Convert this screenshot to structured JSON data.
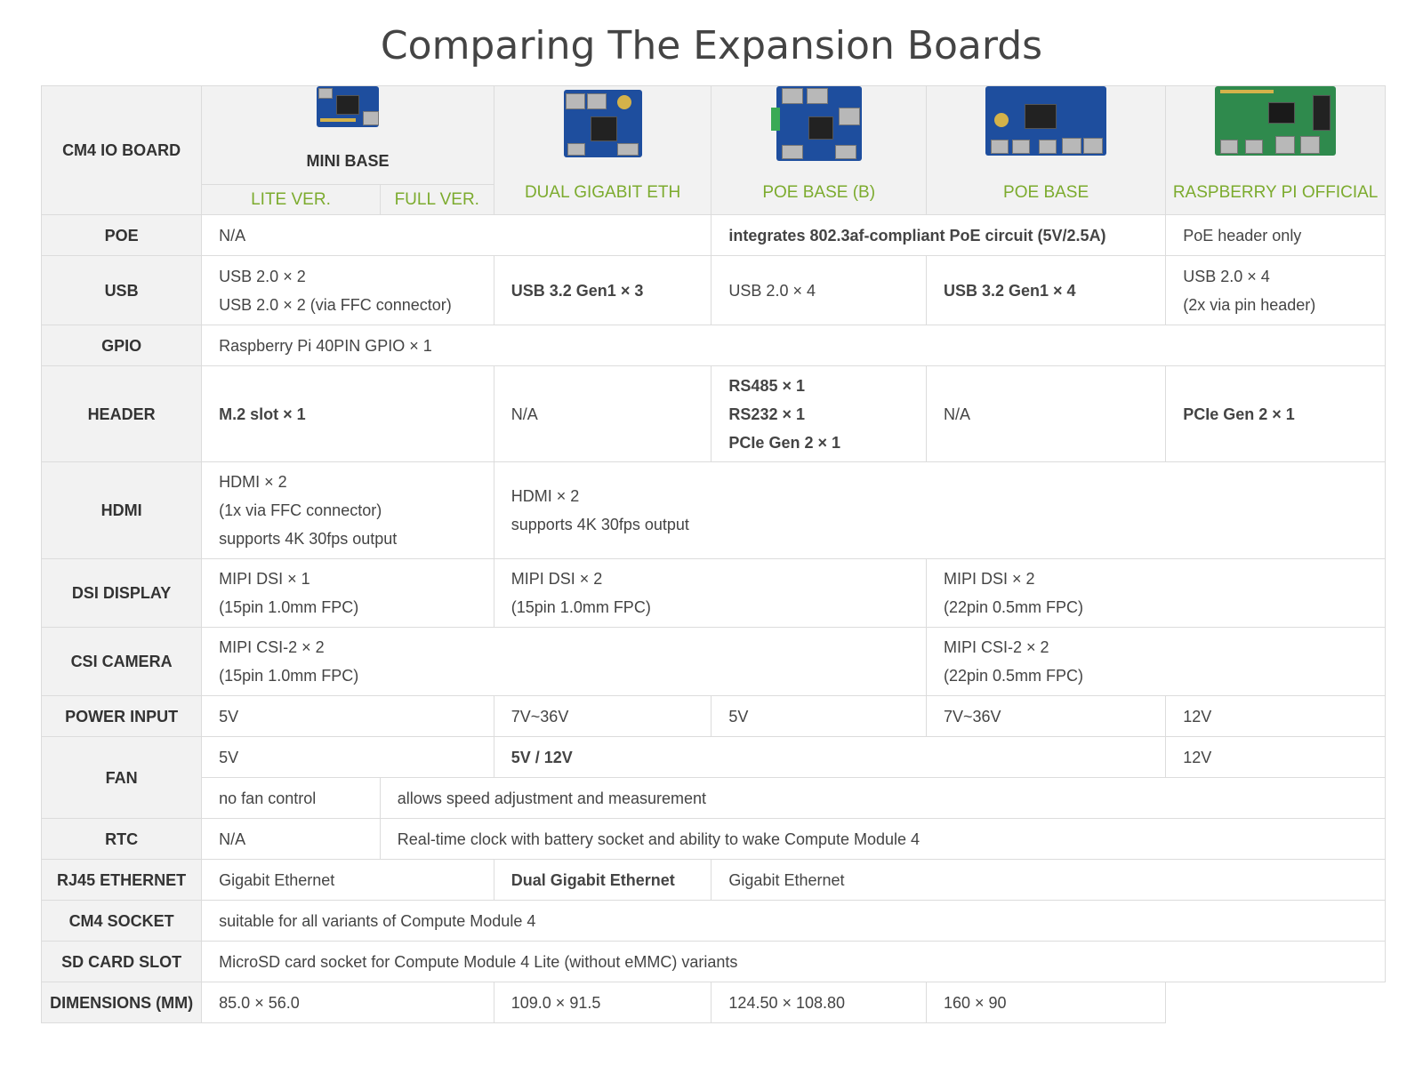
{
  "title": "Comparing The Expansion Boards",
  "header": {
    "corner": "CM4 IO BOARD",
    "mini_base": "MINI BASE",
    "lite": "LITE VER.",
    "full": "FULL VER.",
    "dual_eth": "DUAL GIGABIT ETH",
    "poe_b": "POE BASE (B)",
    "poe": "POE BASE",
    "rpi": "RASPBERRY PI OFFICIAL"
  },
  "rows": {
    "poe": {
      "label": "POE",
      "mini": "N/A",
      "poe_span": "integrates 802.3af-compliant PoE circuit (5V/2.5A)",
      "rpi": "PoE header only"
    },
    "usb": {
      "label": "USB",
      "mini_1": "USB 2.0 × 2",
      "mini_2": "USB 2.0 × 2 (via FFC connector)",
      "dual": "USB 3.2 Gen1 × 3",
      "poe_b": "USB 2.0 × 4",
      "poe": "USB 3.2 Gen1 × 4",
      "rpi_1": "USB 2.0 × 4",
      "rpi_2": "(2x via pin header)"
    },
    "gpio": {
      "label": "GPIO",
      "all": "Raspberry Pi 40PIN GPIO × 1"
    },
    "header": {
      "label": "HEADER",
      "mini": "M.2 slot × 1",
      "dual": "N/A",
      "poe_b_1": "RS485 × 1",
      "poe_b_2": "RS232 × 1",
      "poe_b_3": "PCIe Gen 2 × 1",
      "poe": "N/A",
      "rpi": "PCIe Gen 2 × 1"
    },
    "hdmi": {
      "label": "HDMI",
      "mini_1": "HDMI × 2",
      "mini_2": "(1x via FFC connector)",
      "mini_3": "supports 4K 30fps output",
      "rest_1": "HDMI × 2",
      "rest_2": "supports 4K 30fps output"
    },
    "dsi": {
      "label": "DSI DISPLAY",
      "mini_1": "MIPI DSI × 1",
      "mini_2": "(15pin 1.0mm FPC)",
      "mid_1": "MIPI DSI × 2",
      "mid_2": "(15pin 1.0mm FPC)",
      "right_1": "MIPI DSI × 2",
      "right_2": "(22pin 0.5mm FPC)"
    },
    "csi": {
      "label": "CSI CAMERA",
      "left_1": "MIPI CSI-2 × 2",
      "left_2": "(15pin 1.0mm FPC)",
      "right_1": "MIPI CSI-2 × 2",
      "right_2": "(22pin 0.5mm FPC)"
    },
    "power": {
      "label": "POWER INPUT",
      "mini": "5V",
      "dual": "7V~36V",
      "poe_b": "5V",
      "poe": "7V~36V",
      "rpi": "12V"
    },
    "fan": {
      "label": "FAN",
      "mini_v": "5V",
      "mid_v": "5V / 12V",
      "rpi_v": "12V",
      "lite_ctrl": "no fan control",
      "rest_ctrl": "allows speed adjustment and measurement"
    },
    "rtc": {
      "label": "RTC",
      "lite": "N/A",
      "rest": "Real-time clock with battery socket and ability to wake Compute Module 4"
    },
    "rj45": {
      "label": "RJ45 ETHERNET",
      "mini": "Gigabit Ethernet",
      "dual": "Dual Gigabit Ethernet",
      "rest": "Gigabit Ethernet"
    },
    "socket": {
      "label": "CM4 SOCKET",
      "all": "suitable for all variants of Compute Module 4"
    },
    "sd": {
      "label": "SD CARD SLOT",
      "all": "MicroSD card socket for Compute Module 4 Lite (without eMMC) variants"
    },
    "dims": {
      "label": "DIMENSIONS (MM)",
      "mini": "85.0 × 56.0",
      "dual": "109.0 × 91.5",
      "poe_b": "124.50 × 108.80",
      "poe": "160 × 90"
    }
  },
  "colors": {
    "accent": "#7cab2e",
    "header_bg": "#f2f2f2",
    "border": "#dcdcdc",
    "text": "#444444"
  }
}
